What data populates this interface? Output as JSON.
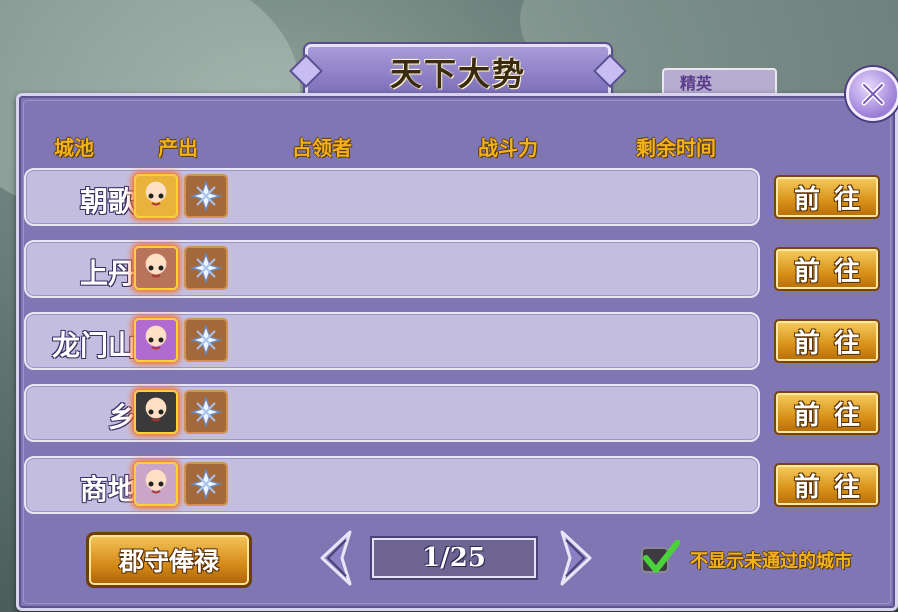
{
  "window": {
    "title": "天下大势"
  },
  "behind_tab": {
    "label": "精英"
  },
  "headers": {
    "city": "城池",
    "output": "产出",
    "occupier": "占领者",
    "power": "战斗力",
    "time_left": "剩余时间"
  },
  "rows": [
    {
      "city": "朝歌",
      "hero_color": "#e9b23a",
      "occupier": "",
      "power": "",
      "time_left": "",
      "go_label": "前往"
    },
    {
      "city": "上丹",
      "hero_color": "#b8745a",
      "occupier": "",
      "power": "",
      "time_left": "",
      "go_label": "前往"
    },
    {
      "city": "龙门山",
      "hero_color": "#b06ad0",
      "occupier": "",
      "power": "",
      "time_left": "",
      "go_label": "前往"
    },
    {
      "city": "乡",
      "hero_color": "#3a3a3a",
      "occupier": "",
      "power": "",
      "time_left": "",
      "go_label": "前往"
    },
    {
      "city": "商地",
      "hero_color": "#c9a6c8",
      "occupier": "",
      "power": "",
      "time_left": "",
      "go_label": "前往"
    }
  ],
  "footer": {
    "salary_button": "郡守俸禄",
    "page": "1/25",
    "filter_label": "不显示未通过的城市",
    "filter_checked": true
  },
  "icons": {
    "close": "close-icon",
    "prev": "chevron-left-icon",
    "next": "chevron-right-icon",
    "crystal": "crystal-icon",
    "check": "checkmark-icon"
  },
  "colors": {
    "panel": "#7f76b3",
    "header_text": "#f3b21c",
    "button_gold": "#d79118"
  }
}
